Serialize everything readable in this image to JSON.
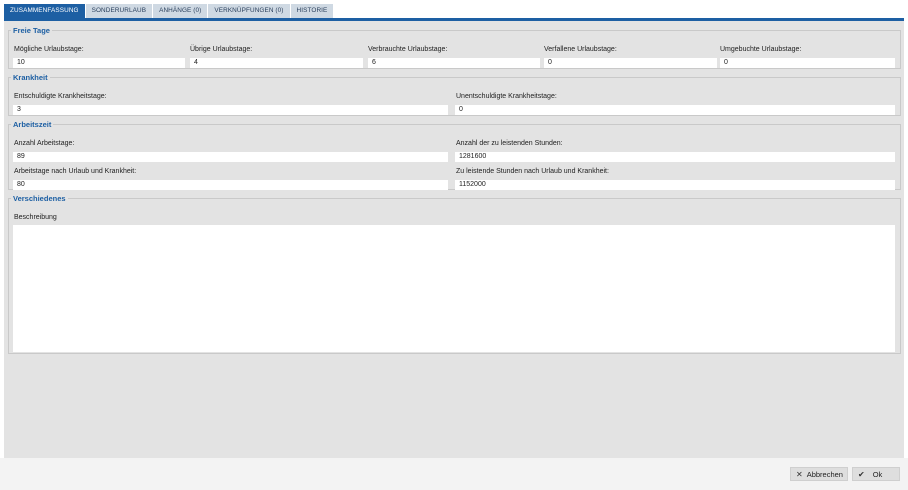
{
  "tabs": [
    {
      "label": "ZUSAMMENFASSUNG",
      "active": true
    },
    {
      "label": "SONDERURLAUB",
      "active": false
    },
    {
      "label": "ANHÄNGE (0)",
      "active": false
    },
    {
      "label": "VERKNÜPFUNGEN (0)",
      "active": false
    },
    {
      "label": "HISTORIE",
      "active": false
    }
  ],
  "freie_tage": {
    "title": "Freie Tage",
    "fields": [
      {
        "label": "Mögliche Urlaubstage:",
        "value": "10"
      },
      {
        "label": "Übrige Urlaubstage:",
        "value": "4"
      },
      {
        "label": "Verbrauchte Urlaubstage:",
        "value": "6"
      },
      {
        "label": "Verfallene Urlaubstage:",
        "value": "0"
      },
      {
        "label": "Umgebuchte Urlaubstage:",
        "value": "0"
      }
    ]
  },
  "krankheit": {
    "title": "Krankheit",
    "fields": [
      {
        "label": "Entschuldigte Krankheitstage:",
        "value": "3"
      },
      {
        "label": "Unentschuldigte Krankheitstage:",
        "value": "0"
      }
    ]
  },
  "arbeitszeit": {
    "title": "Arbeitszeit",
    "fields": [
      {
        "label": "Anzahl Arbeitstage:",
        "value": "89"
      },
      {
        "label": "Anzahl der zu leistenden Stunden:",
        "value": "1281600"
      },
      {
        "label": "Arbeitstage nach Urlaub und Krankheit:",
        "value": "80"
      },
      {
        "label": "Zu leistende Stunden nach Urlaub und Krankheit:",
        "value": "1152000"
      }
    ]
  },
  "verschiedenes": {
    "title": "Verschiedenes",
    "beschreibung_label": "Beschreibung",
    "beschreibung_value": ""
  },
  "footer": {
    "cancel_icon": "close-icon",
    "cancel_label": "Abbrechen",
    "ok_icon": "check-icon",
    "ok_label": "Ok"
  },
  "colors": {
    "accent": "#1d5fa3",
    "panel_background": "#e3e3e3",
    "inactive_tab": "#cfd9e3"
  }
}
